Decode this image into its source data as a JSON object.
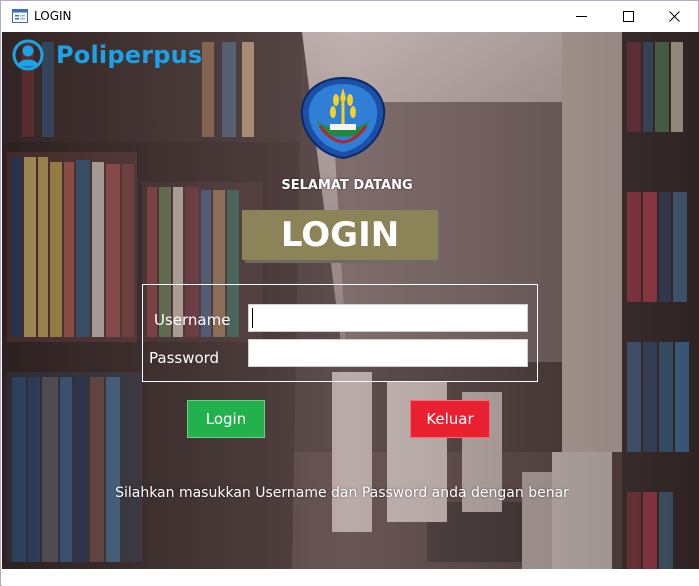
{
  "window": {
    "title": "LOGIN",
    "minimize_icon": "minimize-icon",
    "maximize_icon": "maximize-icon",
    "close_icon": "close-icon"
  },
  "brand": {
    "name": "Poliperpus",
    "icon": "user-avatar-icon",
    "color": "#1aa3e8"
  },
  "logo": {
    "icon": "institution-emblem-icon"
  },
  "welcome": "SELAMAT DATANG",
  "heading": "LOGIN",
  "form": {
    "username_label": "Username",
    "username_value": "",
    "password_label": "Password",
    "password_value": ""
  },
  "buttons": {
    "login": "Login",
    "exit": "Keluar"
  },
  "colors": {
    "login_button": "#22b14c",
    "exit_button": "#e8202f",
    "heading_box": "#8c8358"
  },
  "hint": "Silahkan masukkan Username dan Password anda dengan benar"
}
